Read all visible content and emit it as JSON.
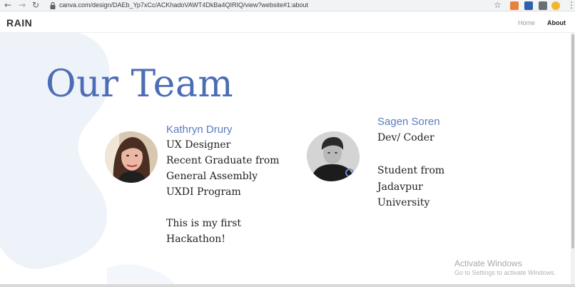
{
  "browser": {
    "url": "canva.com/design/DAEb_Yp7xCc/ACKhadoVAWT4DkBa4QIRIQ/view?website#1:about",
    "back_glyph": "←",
    "forward_glyph": "→",
    "reload_glyph": "↻",
    "star_glyph": "☆",
    "menu_glyph": "⋮",
    "extension_icons": [
      "fox-extension-icon",
      "tl-extension-icon",
      "puzzle-extension-icon",
      "avatar-extension-icon"
    ]
  },
  "site": {
    "brand": "RAIN",
    "nav": {
      "home": "Home",
      "about": "About"
    },
    "colors": {
      "accent": "#4c6db5",
      "name_blue": "#5a7bc0",
      "blob": "#edf1f8"
    }
  },
  "page": {
    "title": "Our Team"
  },
  "team": [
    {
      "name": "Kathryn Drury",
      "bio_lines": [
        "UX Designer",
        "Recent Graduate from",
        "General Assembly",
        "UXDI Program",
        "",
        "This is my first",
        "Hackathon!"
      ]
    },
    {
      "name": "Sagen Soren",
      "bio_lines": [
        "Dev/ Coder",
        "",
        "Student from",
        "Jadavpur",
        "University"
      ]
    }
  ],
  "watermark": {
    "title": "Activate Windows",
    "subtitle": "Go to Settings to activate Windows."
  }
}
